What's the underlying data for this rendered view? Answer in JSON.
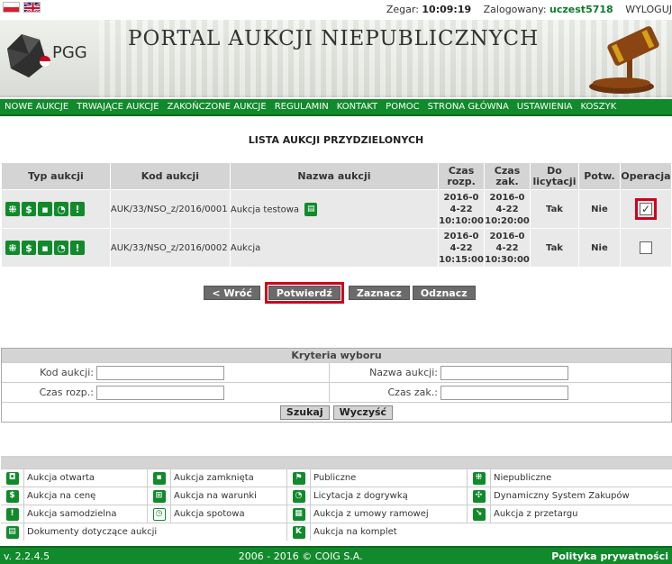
{
  "status": {
    "clock_label": "Zegar:",
    "clock_value": "10:09:19",
    "logged_label": "Zalogowany:",
    "username": "uczest5718",
    "logout_label": "WYLOGUJ"
  },
  "header": {
    "logo_text": "PGG",
    "portal_title": "PORTAL AUKCJI NIEPUBLICZNYCH"
  },
  "menu": [
    "Nowe aukcje",
    "Trwające aukcje",
    "Zakończone aukcje",
    "Regulamin",
    "Kontakt",
    "Pomoc",
    "Strona główna",
    "Ustawienia",
    "Koszyk"
  ],
  "page_title": "LISTA AUKCJI PRZYDZIELONYCH",
  "table": {
    "headers": {
      "type": "Typ aukcji",
      "code": "Kod aukcji",
      "name": "Nazwa aukcji",
      "start": "Czas rozp.",
      "end": "Czas zak.",
      "bid": "Do licytacji",
      "confirm": "Potw.",
      "ops": "Operacja"
    },
    "rows": [
      {
        "code": "AUK/33/NSO_z/2016/0001",
        "name": "Aukcja testowa",
        "start_date": "2016-04-22",
        "start_time": "10:10:00",
        "end_date": "2016-04-22",
        "end_time": "10:20:00",
        "bid": "Tak",
        "confirmed": "Nie",
        "checked": true
      },
      {
        "code": "AUK/33/NSO_z/2016/0002",
        "name": "Aukcja",
        "start_date": "2016-04-22",
        "start_time": "10:15:00",
        "end_date": "2016-04-22",
        "end_time": "10:30:00",
        "bid": "Tak",
        "confirmed": "Nie",
        "checked": false
      }
    ]
  },
  "buttons": {
    "back": "< Wróć",
    "confirm": "Potwierdź",
    "select": "Zaznacz",
    "deselect": "Odznacz"
  },
  "criteria": {
    "title": "Kryteria wyboru",
    "code_label": "Kod aukcji:",
    "name_label": "Nazwa aukcji:",
    "start_label": "Czas rozp.:",
    "end_label": "Czas zak.:",
    "search": "Szukaj",
    "clear": "Wyczyść"
  },
  "legend": {
    "open": "Aukcja otwarta",
    "closed": "Aukcja zamknięta",
    "public": "Publiczne",
    "nonpublic": "Niepubliczne",
    "price": "Aukcja na cenę",
    "conditions": "Aukcja na warunki",
    "overtime": "Licytacja z dogrywką",
    "dps": "Dynamiczny System Zakupów",
    "standalone": "Aukcja samodzielna",
    "spot": "Aukcja spotowa",
    "framework": "Aukcja z umowy ramowej",
    "tender": "Aukcja z przetargu",
    "docs": "Dokumenty dotyczące aukcji",
    "set": "Aukcja na komplet"
  },
  "footer": {
    "version": "v. 2.2.4.5",
    "copyright": "2006 - 2016 © COIG S.A.",
    "privacy": "Polityka prywatności"
  },
  "colors": {
    "brand_green": "#118a2c",
    "date_start": "#0d7a2a",
    "date_end": "#f06a00",
    "no": "#d0021b",
    "highlight": "#d0021b"
  }
}
